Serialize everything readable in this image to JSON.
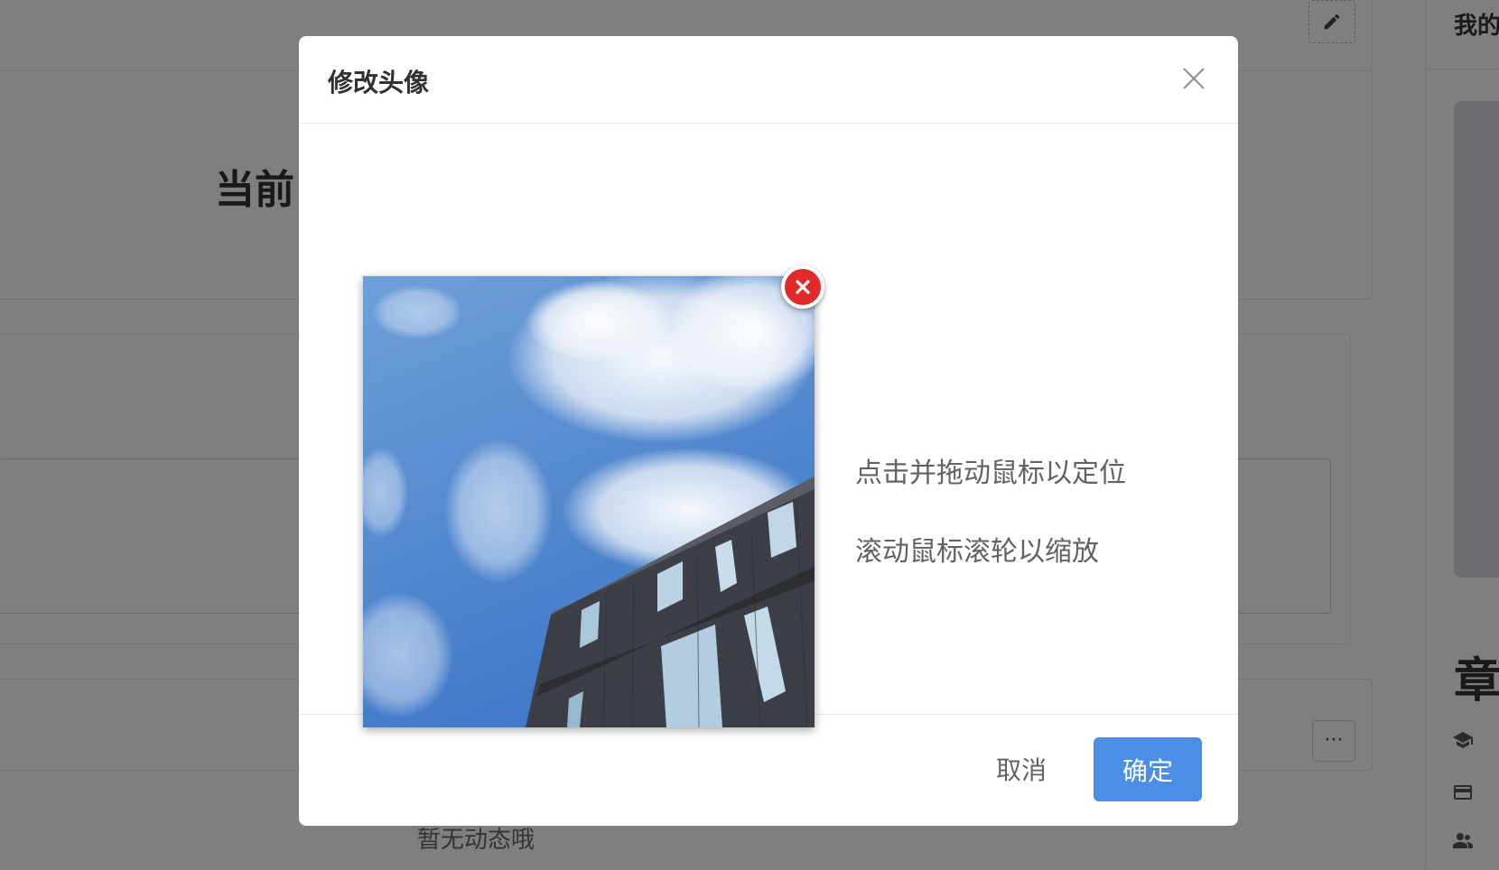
{
  "background": {
    "section_title": "当前",
    "empty_text": "暂无动态哦",
    "right_header": "我的",
    "right_heading": "章",
    "more_label": "···"
  },
  "dialog": {
    "title": "修改头像",
    "hint_drag": "点击并拖动鼠标以定位",
    "hint_zoom": "滚动鼠标滚轮以缩放",
    "cancel_label": "取消",
    "confirm_label": "确定"
  },
  "icons": {
    "close": "close-icon",
    "remove": "remove-image-icon",
    "edit": "pencil-icon",
    "more": "more-horizontal-icon"
  },
  "colors": {
    "primary": "#4a8ee6",
    "danger": "#e02a2a",
    "mask": "rgba(0,0,0,0.5)"
  }
}
